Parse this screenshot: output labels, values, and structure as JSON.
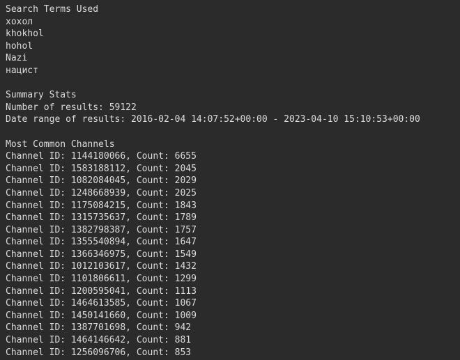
{
  "terminal": {
    "background_color": "#2b2b2b",
    "text_color": "#dcdcdc",
    "search_terms_section": {
      "heading": "Search Terms Used",
      "terms": [
        "хохол",
        "khokhol",
        "hohol",
        "Nazi",
        "нацист"
      ]
    },
    "summary_section": {
      "heading": "Summary Stats",
      "number_of_results_line": "Number of results: 59122",
      "date_range_line": "Date range of results: 2016-02-04 14:07:52+00:00 - 2023-04-10 15:10:53+00:00",
      "number_of_results": "59122",
      "date_range_start": "2016-02-04 14:07:52+00:00",
      "date_range_end": "2023-04-10 15:10:53+00:00"
    },
    "channels_section": {
      "heading": "Most Common Channels",
      "rows": [
        "Channel ID: 1144180066, Count: 6655",
        "Channel ID: 1583188112, Count: 2045",
        "Channel ID: 1082084045, Count: 2029",
        "Channel ID: 1248668939, Count: 2025",
        "Channel ID: 1175084215, Count: 1843",
        "Channel ID: 1315735637, Count: 1789",
        "Channel ID: 1382798387, Count: 1757",
        "Channel ID: 1355540894, Count: 1647",
        "Channel ID: 1366346975, Count: 1549",
        "Channel ID: 1012103617, Count: 1432",
        "Channel ID: 1101806611, Count: 1299",
        "Channel ID: 1200595041, Count: 1113",
        "Channel ID: 1464613585, Count: 1067",
        "Channel ID: 1450141660, Count: 1009",
        "Channel ID: 1387701698, Count: 942",
        "Channel ID: 1464146642, Count: 881",
        "Channel ID: 1256096706, Count: 853"
      ],
      "channels": [
        {
          "id": "1144180066",
          "count": "6655"
        },
        {
          "id": "1583188112",
          "count": "2045"
        },
        {
          "id": "1082084045",
          "count": "2029"
        },
        {
          "id": "1248668939",
          "count": "2025"
        },
        {
          "id": "1175084215",
          "count": "1843"
        },
        {
          "id": "1315735637",
          "count": "1789"
        },
        {
          "id": "1382798387",
          "count": "1757"
        },
        {
          "id": "1355540894",
          "count": "1647"
        },
        {
          "id": "1366346975",
          "count": "1549"
        },
        {
          "id": "1012103617",
          "count": "1432"
        },
        {
          "id": "1101806611",
          "count": "1299"
        },
        {
          "id": "1200595041",
          "count": "1113"
        },
        {
          "id": "1464613585",
          "count": "1067"
        },
        {
          "id": "1450141660",
          "count": "1009"
        },
        {
          "id": "1387701698",
          "count": "942"
        },
        {
          "id": "1464146642",
          "count": "881"
        },
        {
          "id": "1256096706",
          "count": "853"
        }
      ]
    }
  }
}
